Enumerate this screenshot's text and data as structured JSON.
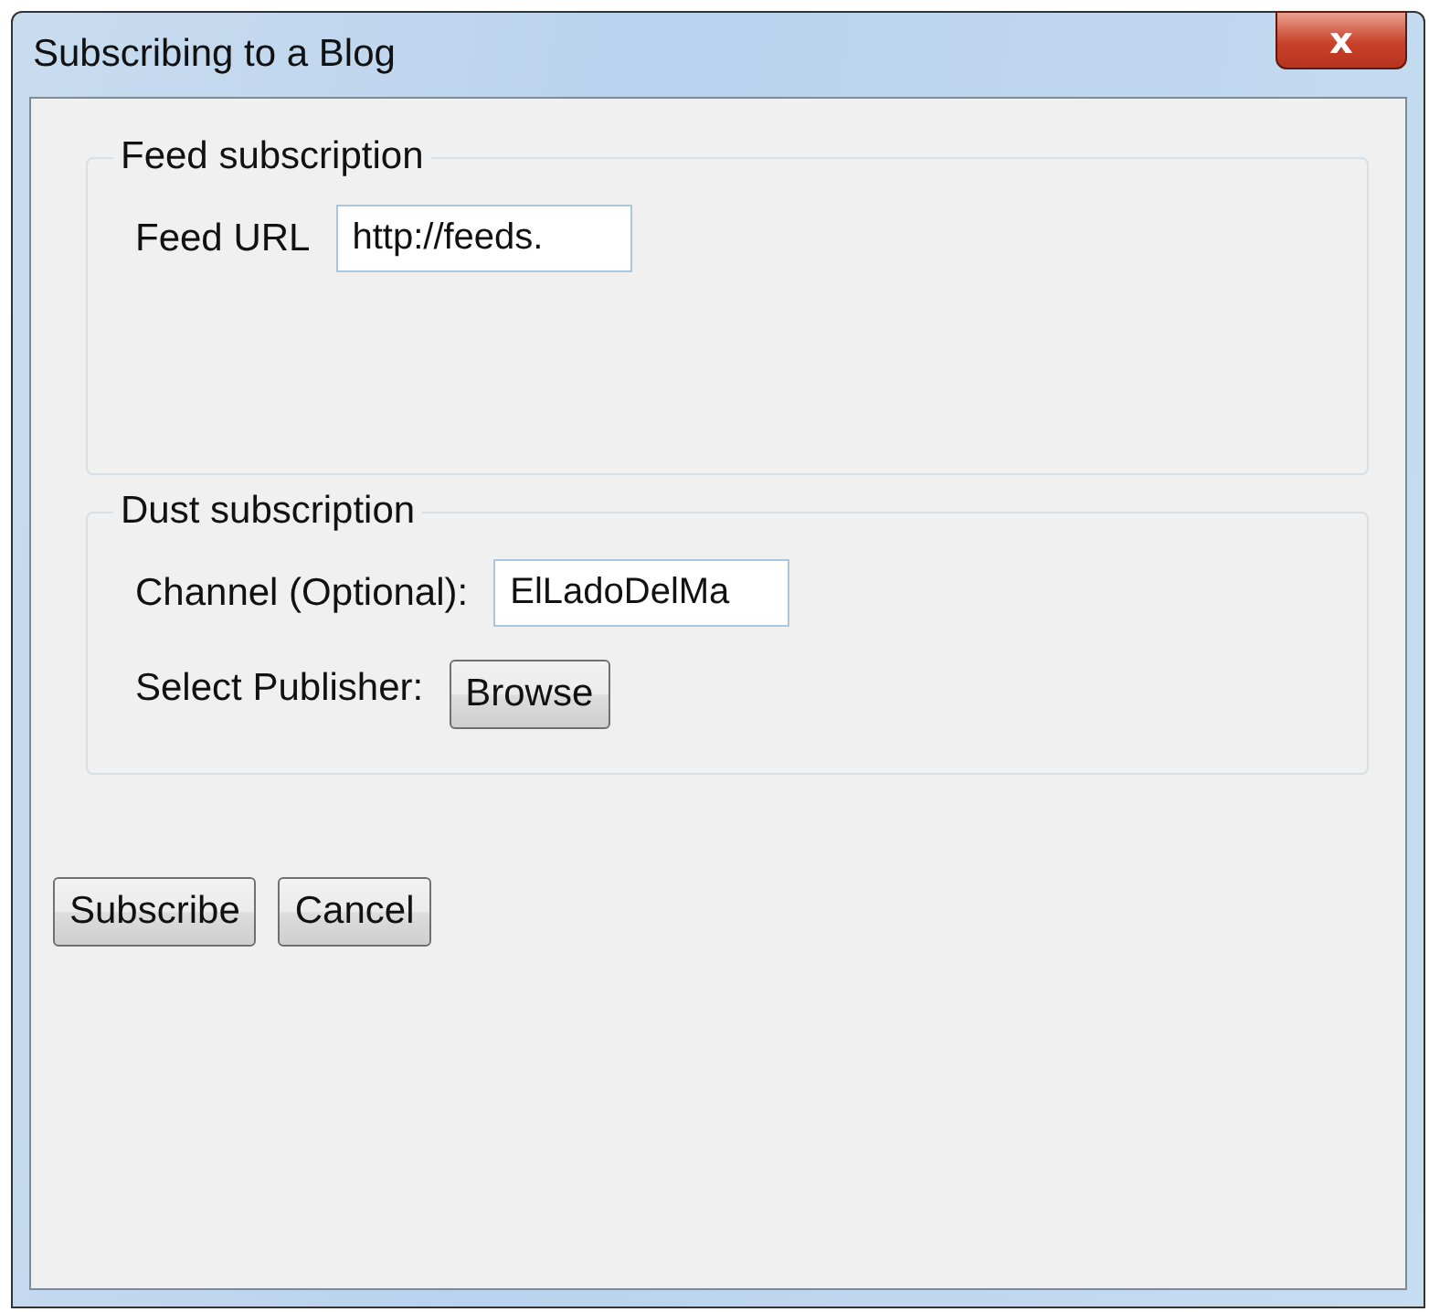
{
  "window": {
    "title": "Subscribing to a Blog",
    "close_label": "x"
  },
  "groups": [
    {
      "title": "Feed subscription",
      "rows": [
        {
          "kind": "field",
          "label": "Feed URL",
          "value": "http://feeds."
        }
      ]
    },
    {
      "title": "Dust subscription",
      "rows": [
        {
          "kind": "field",
          "label": "Channel (Optional):",
          "value": "ElLadoDelMa"
        },
        {
          "kind": "button",
          "label": "Select Publisher:",
          "button": "Browse"
        }
      ]
    }
  ],
  "buttons": [
    "Subscribe",
    "Cancel"
  ]
}
